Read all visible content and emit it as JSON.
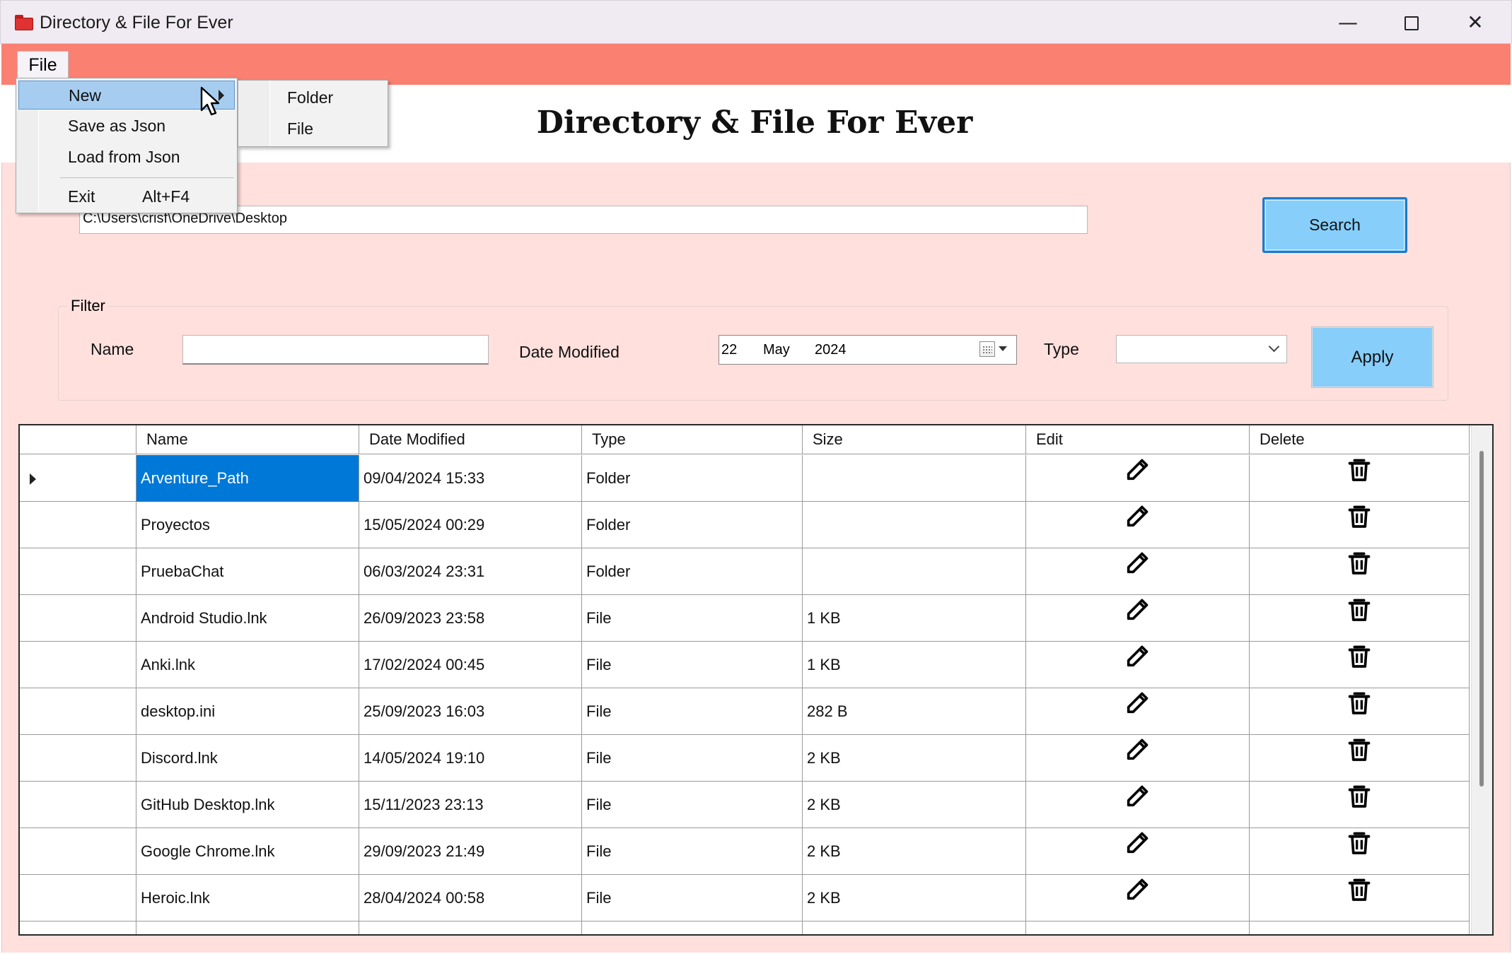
{
  "window": {
    "title": "Directory & File For Ever",
    "controls": {
      "minimize": "—",
      "maximize": "",
      "close": "✕"
    }
  },
  "menubar": {
    "file_label": "File"
  },
  "menu": {
    "items": [
      {
        "label": "New",
        "highlighted": true,
        "has_submenu": true
      },
      {
        "label": "Save as Json"
      },
      {
        "label": "Load from Json"
      },
      {
        "label": "Exit",
        "shortcut": "Alt+F4"
      }
    ],
    "submenu": [
      "Folder",
      "File"
    ]
  },
  "header": {
    "title": "Directory & File For Ever"
  },
  "path": {
    "value": "C:\\Users\\crisf\\OneDrive\\Desktop"
  },
  "search_button": "Search",
  "filter": {
    "legend": "Filter",
    "name_label": "Name",
    "name_value": "",
    "date_label": "Date Modified",
    "date": {
      "day": "22",
      "month": "May",
      "year": "2024"
    },
    "type_label": "Type",
    "type_value": "",
    "apply_label": "Apply"
  },
  "table": {
    "columns": [
      "Name",
      "Date Modified",
      "Type",
      "Size",
      "Edit",
      "Delete"
    ],
    "rows": [
      {
        "name": "Arventure_Path",
        "date": "09/04/2024 15:33",
        "type": "Folder",
        "size": ""
      },
      {
        "name": "Proyectos",
        "date": "15/05/2024 00:29",
        "type": "Folder",
        "size": ""
      },
      {
        "name": "PruebaChat",
        "date": "06/03/2024 23:31",
        "type": "Folder",
        "size": ""
      },
      {
        "name": "Android Studio.lnk",
        "date": "26/09/2023 23:58",
        "type": "File",
        "size": "1 KB"
      },
      {
        "name": "Anki.lnk",
        "date": "17/02/2024 00:45",
        "type": "File",
        "size": "1 KB"
      },
      {
        "name": "desktop.ini",
        "date": "25/09/2023 16:03",
        "type": "File",
        "size": "282 B"
      },
      {
        "name": "Discord.lnk",
        "date": "14/05/2024 19:10",
        "type": "File",
        "size": "2 KB"
      },
      {
        "name": "GitHub Desktop.lnk",
        "date": "15/11/2023 23:13",
        "type": "File",
        "size": "2 KB"
      },
      {
        "name": "Google Chrome.lnk",
        "date": "29/09/2023 21:49",
        "type": "File",
        "size": "2 KB"
      },
      {
        "name": "Heroic.lnk",
        "date": "28/04/2024 00:58",
        "type": "File",
        "size": "2 KB"
      }
    ],
    "icons": {
      "edit": "pencil-icon",
      "delete": "trash-icon"
    }
  },
  "colors": {
    "menubar": "#fa8072",
    "body_background": "#ffe0dd",
    "button": "#87cefa",
    "selection": "#0078d7",
    "menu_highlight": "#a6cdf0"
  }
}
